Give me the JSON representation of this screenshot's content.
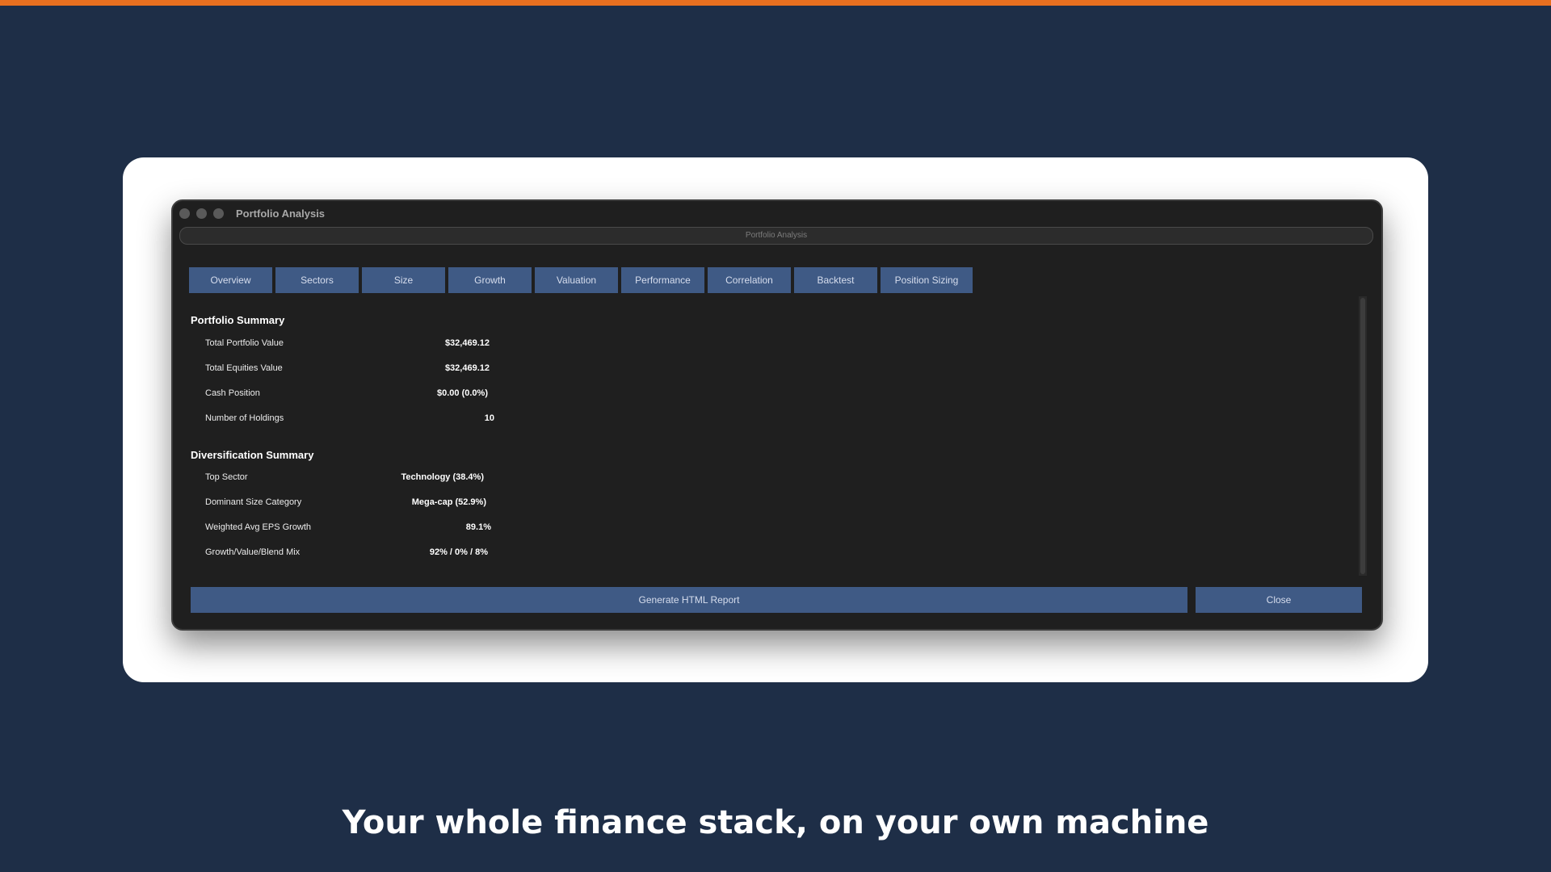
{
  "brand": {
    "accent": "#e86f1f",
    "background": "#1e2e47",
    "button": "#3f5a85"
  },
  "window": {
    "title": "Portfolio Analysis",
    "header": "Portfolio Analysis"
  },
  "tabs": [
    "Overview",
    "Sectors",
    "Size",
    "Growth",
    "Valuation",
    "Performance",
    "Correlation",
    "Backtest",
    "Position Sizing"
  ],
  "portfolio_summary": {
    "title": "Portfolio Summary",
    "rows": [
      {
        "label": "Total Portfolio Value",
        "value": "$32,469.12"
      },
      {
        "label": "Total Equities Value",
        "value": "$32,469.12"
      },
      {
        "label": "Cash Position",
        "value": "$0.00 (0.0%)"
      },
      {
        "label": "Number of Holdings",
        "value": "10"
      }
    ]
  },
  "diversification_summary": {
    "title": "Diversification Summary",
    "rows": [
      {
        "label": "Top Sector",
        "value": "Technology (38.4%)"
      },
      {
        "label": "Dominant Size Category",
        "value": "Mega-cap (52.9%)"
      },
      {
        "label": "Weighted Avg EPS Growth",
        "value": "89.1%"
      },
      {
        "label": "Growth/Value/Blend Mix",
        "value": "92% / 0% / 8%"
      }
    ]
  },
  "buttons": {
    "generate": "Generate HTML Report",
    "close": "Close"
  },
  "tagline": "Your whole finance stack, on your own machine"
}
